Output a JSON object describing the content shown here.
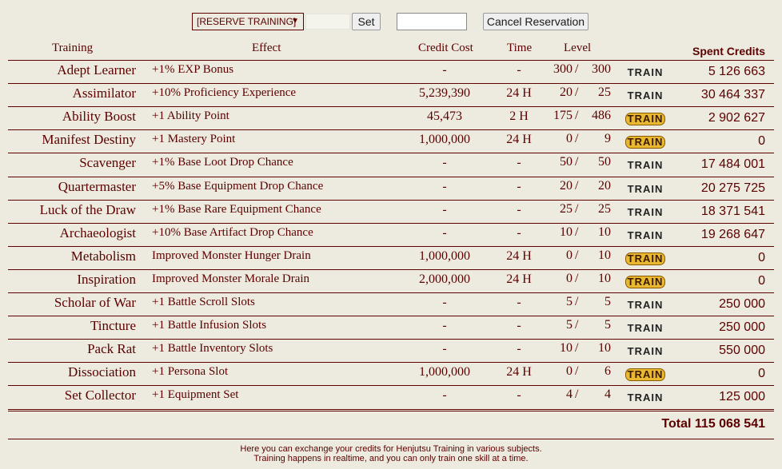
{
  "controls": {
    "reserve_select": "[RESERVE TRAINING]",
    "reserve_input": "",
    "set_label": "Set",
    "cancel_input": "",
    "cancel_label": "Cancel Reservation"
  },
  "headers": {
    "training": "Training",
    "effect": "Effect",
    "cost": "Credit Cost",
    "time": "Time",
    "level": "Level",
    "spent": "Spent Credits"
  },
  "rows": [
    {
      "name": "Adept Learner",
      "effect": "+1% EXP Bonus",
      "cost": "-",
      "time": "-",
      "level": "300",
      "slash": "/",
      "max": "300",
      "train": "TRAIN",
      "active": false,
      "spent": "5 126 663"
    },
    {
      "name": "Assimilator",
      "effect": "+10% Proficiency Experience",
      "cost": "5,239,390",
      "time": "24 H",
      "level": "20",
      "slash": "/",
      "max": "25",
      "train": "TRAIN",
      "active": false,
      "spent": "30 464 337"
    },
    {
      "name": "Ability Boost",
      "effect": "+1 Ability Point",
      "cost": "45,473",
      "time": "2 H",
      "level": "175",
      "slash": "/",
      "max": "486",
      "train": "TRAIN",
      "active": true,
      "spent": "2 902 627"
    },
    {
      "name": "Manifest Destiny",
      "effect": "+1 Mastery Point",
      "cost": "1,000,000",
      "time": "24 H",
      "level": "0",
      "slash": "/",
      "max": "9",
      "train": "TRAIN",
      "active": true,
      "spent": "0"
    },
    {
      "name": "Scavenger",
      "effect": "+1% Base Loot Drop Chance",
      "cost": "-",
      "time": "-",
      "level": "50",
      "slash": "/",
      "max": "50",
      "train": "TRAIN",
      "active": false,
      "spent": "17 484 001"
    },
    {
      "name": "Quartermaster",
      "effect": "+5% Base Equipment Drop Chance",
      "cost": "-",
      "time": "-",
      "level": "20",
      "slash": "/",
      "max": "20",
      "train": "TRAIN",
      "active": false,
      "spent": "20 275 725"
    },
    {
      "name": "Luck of the Draw",
      "effect": "+1% Base Rare Equipment Chance",
      "cost": "-",
      "time": "-",
      "level": "25",
      "slash": "/",
      "max": "25",
      "train": "TRAIN",
      "active": false,
      "spent": "18 371 541"
    },
    {
      "name": "Archaeologist",
      "effect": "+10% Base Artifact Drop Chance",
      "cost": "-",
      "time": "-",
      "level": "10",
      "slash": "/",
      "max": "10",
      "train": "TRAIN",
      "active": false,
      "spent": "19 268 647"
    },
    {
      "name": "Metabolism",
      "effect": "Improved Monster Hunger Drain",
      "cost": "1,000,000",
      "time": "24 H",
      "level": "0",
      "slash": "/",
      "max": "10",
      "train": "TRAIN",
      "active": true,
      "spent": "0"
    },
    {
      "name": "Inspiration",
      "effect": "Improved Monster Morale Drain",
      "cost": "2,000,000",
      "time": "24 H",
      "level": "0",
      "slash": "/",
      "max": "10",
      "train": "TRAIN",
      "active": true,
      "spent": "0"
    },
    {
      "name": "Scholar of War",
      "effect": "+1 Battle Scroll Slots",
      "cost": "-",
      "time": "-",
      "level": "5",
      "slash": "/",
      "max": "5",
      "train": "TRAIN",
      "active": false,
      "spent": "250 000"
    },
    {
      "name": "Tincture",
      "effect": "+1 Battle Infusion Slots",
      "cost": "-",
      "time": "-",
      "level": "5",
      "slash": "/",
      "max": "5",
      "train": "TRAIN",
      "active": false,
      "spent": "250 000"
    },
    {
      "name": "Pack Rat",
      "effect": "+1 Battle Inventory Slots",
      "cost": "-",
      "time": "-",
      "level": "10",
      "slash": "/",
      "max": "10",
      "train": "TRAIN",
      "active": false,
      "spent": "550 000"
    },
    {
      "name": "Dissociation",
      "effect": "+1 Persona Slot",
      "cost": "1,000,000",
      "time": "24 H",
      "level": "0",
      "slash": "/",
      "max": "6",
      "train": "TRAIN",
      "active": true,
      "spent": "0"
    },
    {
      "name": "Set Collector",
      "effect": "+1 Equipment Set",
      "cost": "-",
      "time": "-",
      "level": "4",
      "slash": "/",
      "max": "4",
      "train": "TRAIN",
      "active": false,
      "spent": "125 000"
    }
  ],
  "total": "Total 115 068 541",
  "footer": {
    "line1": "Here you can exchange your credits for Henjutsu Training in various subjects.",
    "line2": "Training happens in realtime, and you can only train one skill at a time."
  }
}
